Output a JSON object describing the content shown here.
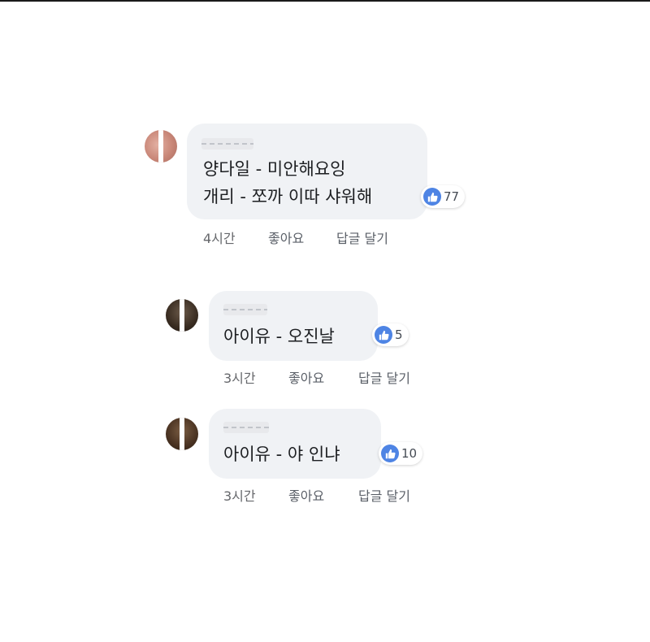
{
  "comments": [
    {
      "name": "",
      "lines": [
        "양다일 - 미안해요잉",
        "개리 - 쪼까 이따 샤워해"
      ],
      "reaction_count": "77",
      "time": "4시간",
      "like_label": "좋아요",
      "reply_label": "답글 달기"
    },
    {
      "name": "",
      "lines": [
        "아이유 - 오진날"
      ],
      "reaction_count": "5",
      "time": "3시간",
      "like_label": "좋아요",
      "reply_label": "답글 달기"
    },
    {
      "name": "",
      "lines": [
        "아이유 - 야 인냐"
      ],
      "reaction_count": "10",
      "time": "3시간",
      "like_label": "좋아요",
      "reply_label": "답글 달기"
    }
  ],
  "colors": {
    "bubble": "#f0f2f5",
    "like_icon": "#4e84e4",
    "text": "#1c1e21",
    "meta": "#65676b"
  },
  "icons": {
    "reaction": "thumbs-up-icon",
    "avatar": "profile-photo"
  }
}
